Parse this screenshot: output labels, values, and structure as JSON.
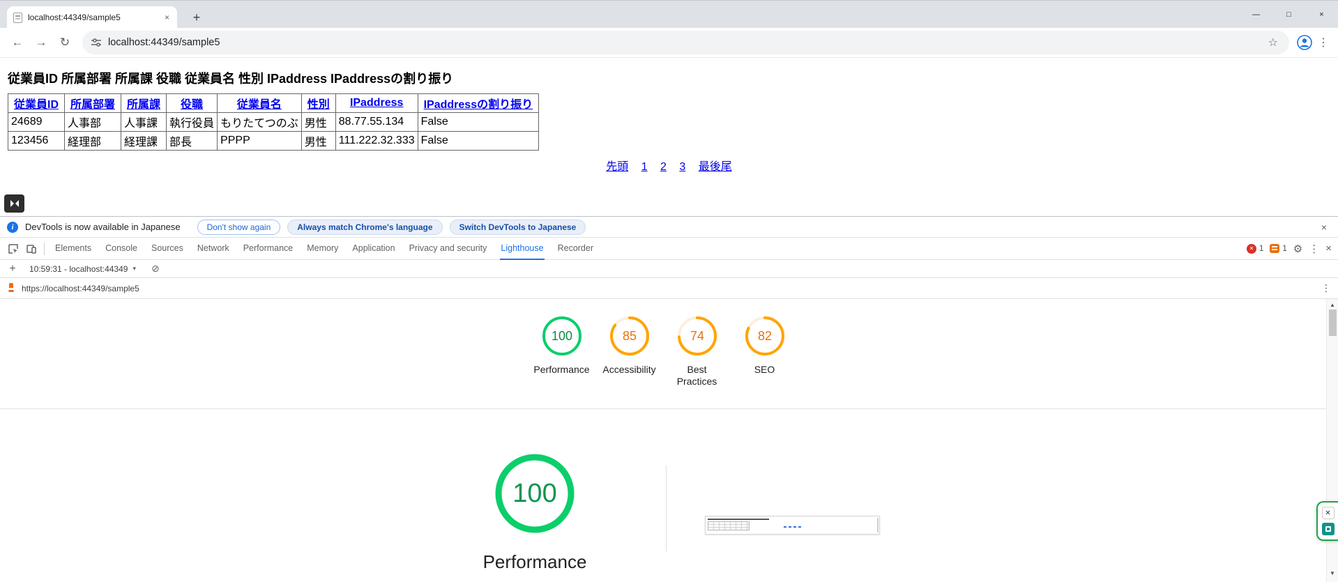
{
  "browser": {
    "tab_title": "localhost:44349/sample5",
    "url": "localhost:44349/sample5"
  },
  "icons": {
    "back": "←",
    "forward": "→",
    "reload": "↻",
    "star": "☆",
    "menu_kebab": "⋮",
    "window_min": "—",
    "window_max": "□",
    "window_close": "×",
    "tab_close": "×",
    "new_tab": "+",
    "info_letter": "i",
    "infobar_close": "×",
    "plus": "+",
    "caret_down": "▾",
    "block": "⊘",
    "gear": "⚙",
    "dt_close": "×",
    "scroll_up": "▲",
    "scroll_down": "▼",
    "error_x": "✕",
    "widget_close": "✕"
  },
  "page": {
    "heading": "従業員ID 所属部署 所属課 役職 従業員名 性別 IPaddress IPaddressの割り振り",
    "table": {
      "headers": [
        "従業員ID",
        "所属部署",
        "所属課",
        "役職",
        "従業員名",
        "性別",
        "IPaddress",
        "IPaddressの割り振り"
      ],
      "rows": [
        [
          "24689",
          "人事部",
          "人事課",
          "執行役員",
          "もりたてつのぶ",
          "男性",
          "88.77.55.134",
          "False"
        ],
        [
          "123456",
          "経理部",
          "経理課",
          "部長",
          "PPPP",
          "男性",
          "111.222.32.333",
          "False"
        ]
      ]
    },
    "pagination": [
      "先頭",
      "1",
      "2",
      "3",
      "最後尾"
    ]
  },
  "devtools": {
    "infobar": {
      "message": "DevTools is now available in Japanese",
      "dismiss_label": "Don't show again",
      "match_label": "Always match Chrome's language",
      "switch_label": "Switch DevTools to Japanese"
    },
    "tabs": [
      "Elements",
      "Console",
      "Sources",
      "Network",
      "Performance",
      "Memory",
      "Application",
      "Privacy and security",
      "Lighthouse",
      "Recorder"
    ],
    "active_tab": "Lighthouse",
    "error_count": "1",
    "issue_count": "1",
    "session_label": "10:59:31 - localhost:44349"
  },
  "lighthouse": {
    "url": "https://localhost:44349/sample5",
    "scores": [
      {
        "label": "Performance",
        "value": "100",
        "ring": "#0cce6b",
        "faint": "#e6f7ed",
        "text_color": "#0d8a45"
      },
      {
        "label": "Accessibility",
        "value": "85",
        "ring": "#ffa400",
        "faint": "#fcefdc",
        "text_color": "#e8720c"
      },
      {
        "label": "Best Practices",
        "value": "74",
        "ring": "#ffa400",
        "faint": "#fcefdc",
        "text_color": "#e8720c"
      },
      {
        "label": "SEO",
        "value": "82",
        "ring": "#ffa400",
        "faint": "#fcefdc",
        "text_color": "#e8720c"
      }
    ],
    "main_gauge": {
      "label": "Performance",
      "value": "100",
      "ring": "#0cce6b",
      "faint": "#e6f7ed",
      "text_color": "#0d9550"
    }
  }
}
